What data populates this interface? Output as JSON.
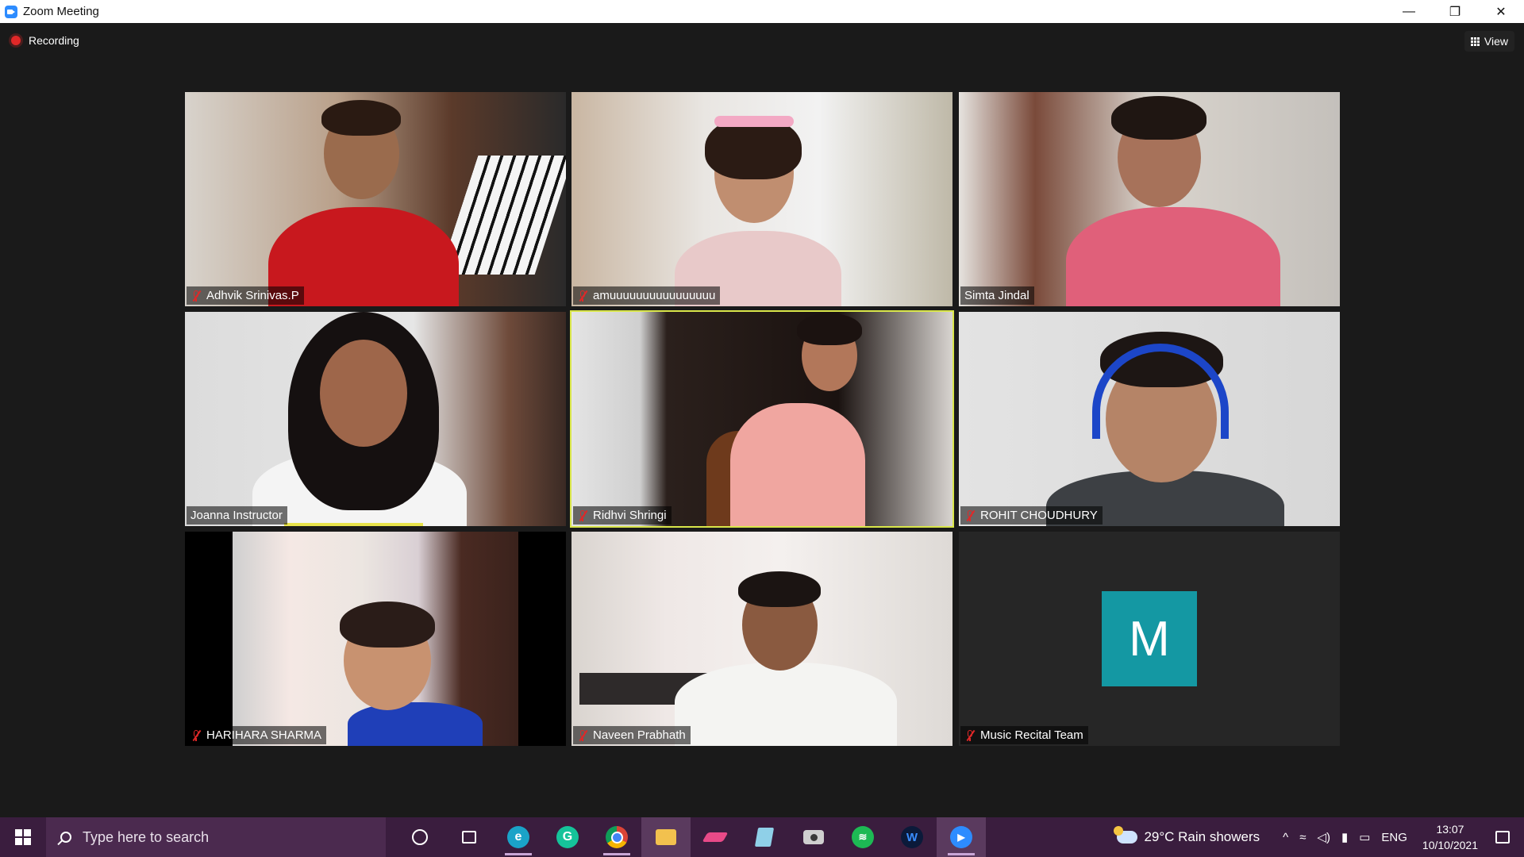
{
  "window": {
    "title": "Zoom Meeting",
    "minimize": "—",
    "restore": "❐",
    "close": "✕"
  },
  "meeting": {
    "recording_label": "Recording",
    "view_label": "View",
    "participants": [
      {
        "name": "Adhvik Srinivas.P",
        "muted": true
      },
      {
        "name": "amuuuuuuuuuuuuuuuu",
        "muted": true
      },
      {
        "name": "Simta Jindal",
        "muted": false
      },
      {
        "name": "Joanna Instructor",
        "muted": false
      },
      {
        "name": "Ridhvi Shringi",
        "muted": true
      },
      {
        "name": "ROHIT CHOUDHURY",
        "muted": true
      },
      {
        "name": "HARIHARA SHARMA",
        "muted": true
      },
      {
        "name": "Naveen Prabhath",
        "muted": true
      },
      {
        "name": "Music Recital Team",
        "muted": true,
        "avatar_letter": "M"
      }
    ]
  },
  "taskbar": {
    "search_placeholder": "Type here to search",
    "weather": "29°C  Rain showers",
    "language": "ENG",
    "time": "13:07",
    "date": "10/10/2021"
  },
  "colors": {
    "active_speaker": "#d9e64a",
    "muted_red": "#e02828",
    "avatar_bg": "#1498a3",
    "taskbar_bg": "#3a1d3e"
  }
}
